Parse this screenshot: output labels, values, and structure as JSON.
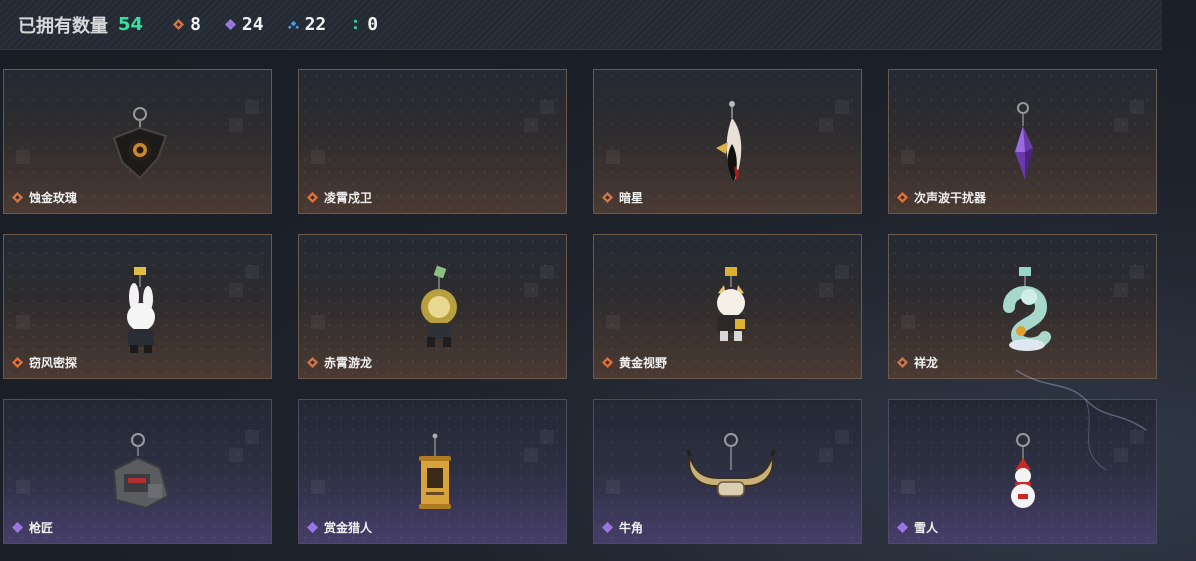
{
  "header": {
    "owned_label": "已拥有数量",
    "owned_count": "54",
    "rarities": [
      {
        "icon": "orange-diamond-icon",
        "color": "#e0733a",
        "count": "8"
      },
      {
        "icon": "purple-diamond-icon",
        "color": "#9b78e8",
        "count": "24"
      },
      {
        "icon": "blue-chevron-icon",
        "color": "#4a9ee8",
        "count": "22"
      },
      {
        "icon": "green-dots-icon",
        "color": "#3ad3a0",
        "count": "0"
      }
    ]
  },
  "items": [
    {
      "name": "蚀金玫瑰",
      "rarity": "orange",
      "icon": "dark-rose-charm-icon"
    },
    {
      "name": "凌霄戍卫",
      "rarity": "orange",
      "icon": ""
    },
    {
      "name": "暗星",
      "rarity": "orange",
      "icon": "dark-star-blade-charm-icon"
    },
    {
      "name": "次声波干扰器",
      "rarity": "orange",
      "icon": "purple-crystal-charm-icon"
    },
    {
      "name": "窃风密探",
      "rarity": "orange",
      "icon": "rabbit-figure-charm-icon"
    },
    {
      "name": "赤霄游龙",
      "rarity": "orange",
      "icon": "lion-figure-charm-icon"
    },
    {
      "name": "黄金视野",
      "rarity": "orange",
      "icon": "cat-figure-charm-icon"
    },
    {
      "name": "祥龙",
      "rarity": "orange",
      "icon": "jade-dragon-charm-icon"
    },
    {
      "name": "枪匠",
      "rarity": "purple",
      "icon": "dog-tag-charm-icon"
    },
    {
      "name": "赏金猎人",
      "rarity": "purple",
      "icon": "wanted-poster-charm-icon"
    },
    {
      "name": "牛角",
      "rarity": "purple",
      "icon": "bull-horn-charm-icon"
    },
    {
      "name": "雪人",
      "rarity": "purple",
      "icon": "snowman-charm-icon"
    }
  ],
  "colors": {
    "orange_gem": "#e0733a",
    "purple_gem": "#9b78e8",
    "count_green": "#34e29b"
  }
}
